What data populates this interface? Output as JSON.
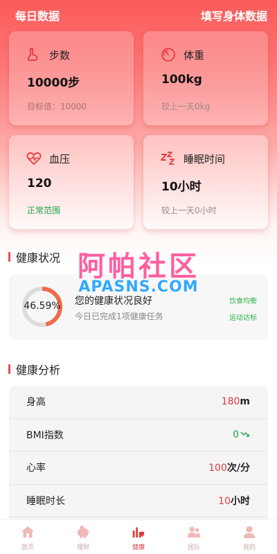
{
  "header": {
    "title": "每日数据",
    "action": "填写身体数据"
  },
  "cards": {
    "steps": {
      "icon": "foot-icon",
      "label": "步数",
      "value": "10000步",
      "sub": "目标值：10000"
    },
    "weight": {
      "icon": "scale-gauge-icon",
      "label": "体重",
      "value": "100kg",
      "sub": "较上一天0kg"
    },
    "blood": {
      "icon": "heart-pulse-icon",
      "label": "血压",
      "value": "120",
      "sub": "正常范围"
    },
    "sleep": {
      "icon": "zzz-icon",
      "label": "睡眠时间",
      "value": "10小时",
      "sub": "较上一天0小时"
    }
  },
  "health_status": {
    "title": "健康状况",
    "percent_text": "46.59%",
    "percent": 46.59,
    "headline": "您的健康状况良好",
    "subline": "今日已完成1项健康任务",
    "tags": [
      "饮食均衡",
      "运动达标"
    ]
  },
  "watermark": {
    "line1": "阿帕社区",
    "line2": "APASNS.COM"
  },
  "analysis": {
    "title": "健康分析",
    "rows": [
      {
        "label": "身高",
        "value": "180",
        "unit": "m"
      },
      {
        "label": "BMI指数",
        "value": "0",
        "unit": "",
        "trend": "down-trend-icon"
      },
      {
        "label": "心率",
        "value": "100",
        "unit": "次/分"
      },
      {
        "label": "睡眠时长",
        "value": "10",
        "unit": "小时"
      }
    ]
  },
  "tabs": [
    {
      "label": "首页",
      "icon": "home-icon"
    },
    {
      "label": "理财",
      "icon": "piggy-bank-icon"
    },
    {
      "label": "健康",
      "icon": "health-chart-icon",
      "active": true
    },
    {
      "label": "团队",
      "icon": "team-icon"
    },
    {
      "label": "我的",
      "icon": "user-icon"
    }
  ],
  "colors": {
    "accent": "#e23b3b",
    "green": "#1aa34a",
    "header_red": "#fb5a5a"
  }
}
